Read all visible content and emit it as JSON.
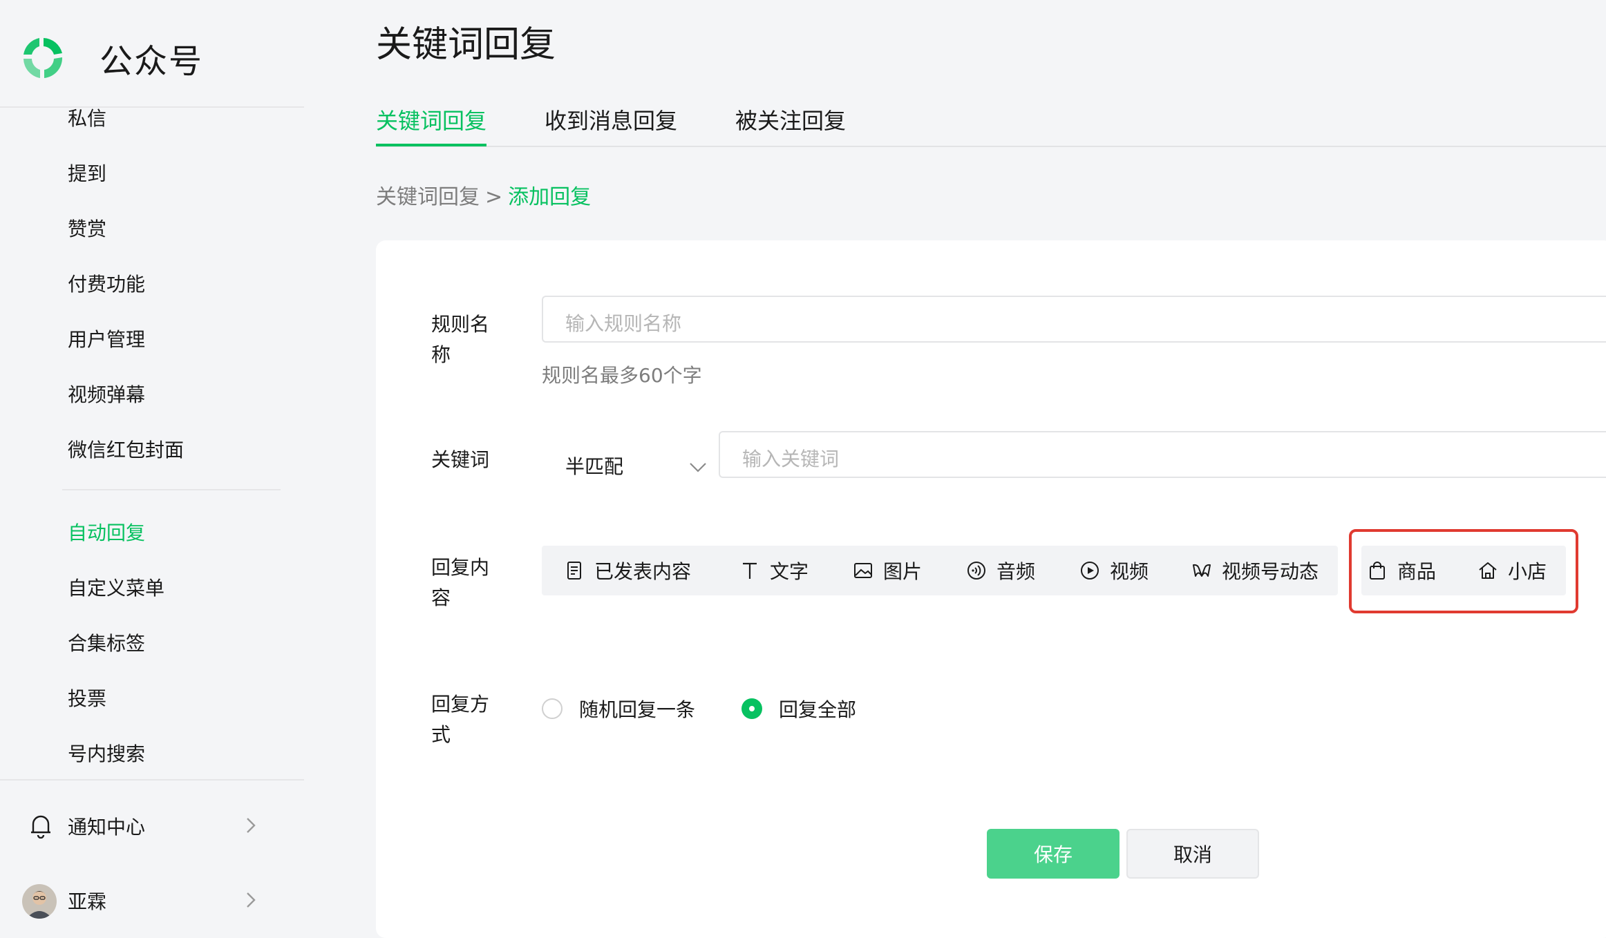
{
  "brand": {
    "name": "公众号"
  },
  "sidebar": {
    "items": [
      {
        "label": "私信"
      },
      {
        "label": "提到"
      },
      {
        "label": "赞赏"
      },
      {
        "label": "付费功能"
      },
      {
        "label": "用户管理"
      },
      {
        "label": "视频弹幕"
      },
      {
        "label": "微信红包封面"
      }
    ],
    "group2": [
      {
        "label": "自动回复",
        "active": true
      },
      {
        "label": "自定义菜单"
      },
      {
        "label": "合集标签"
      },
      {
        "label": "投票"
      },
      {
        "label": "号内搜索"
      }
    ],
    "notifications_label": "通知中心",
    "user_name": "亚霖"
  },
  "header": {
    "title": "关键词回复",
    "tabs": [
      {
        "label": "关键词回复",
        "active": true
      },
      {
        "label": "收到消息回复"
      },
      {
        "label": "被关注回复"
      }
    ],
    "breadcrumb": {
      "parent": "关键词回复",
      "separator": ">",
      "current": "添加回复"
    }
  },
  "form": {
    "rule_name": {
      "label_line1": "规则名",
      "label_line2": "称",
      "placeholder": "输入规则名称",
      "hint": "规则名最多60个字"
    },
    "keyword": {
      "label": "关键词",
      "match_mode": "半匹配",
      "placeholder": "输入关键词"
    },
    "reply_content": {
      "label_line1": "回复内",
      "label_line2": "容",
      "types": [
        {
          "label": "已发表内容",
          "icon": "document-icon"
        },
        {
          "label": "文字",
          "icon": "text-icon"
        },
        {
          "label": "图片",
          "icon": "image-icon"
        },
        {
          "label": "音频",
          "icon": "audio-icon"
        },
        {
          "label": "视频",
          "icon": "video-icon"
        },
        {
          "label": "视频号动态",
          "icon": "channels-icon"
        }
      ],
      "highlighted_types": [
        {
          "label": "商品",
          "icon": "shopping-bag-icon"
        },
        {
          "label": "小店",
          "icon": "store-icon"
        }
      ]
    },
    "reply_mode": {
      "label_line1": "回复方",
      "label_line2": "式",
      "options": [
        {
          "label": "随机回复一条",
          "checked": false
        },
        {
          "label": "回复全部",
          "checked": true
        }
      ]
    },
    "save_label": "保存",
    "cancel_label": "取消"
  },
  "colors": {
    "accent": "#07c160",
    "highlight": "#e03a30"
  }
}
